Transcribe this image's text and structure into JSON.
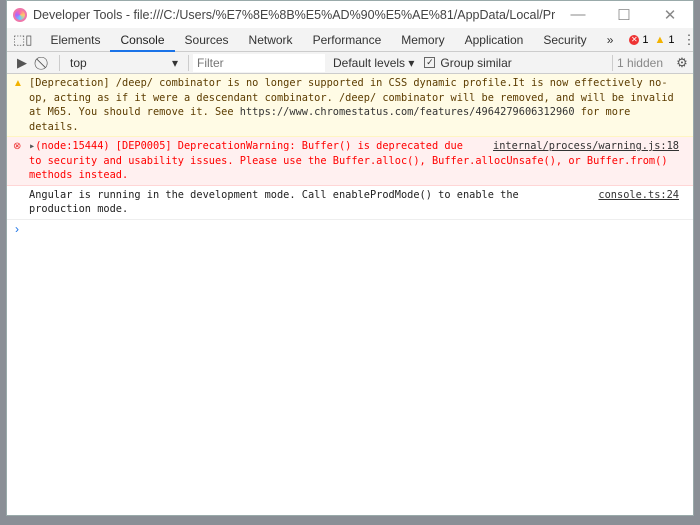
{
  "window": {
    "title": "Developer Tools - file:///C:/Users/%E7%8E%8B%E5%AD%90%E5%AE%81/AppData/Local/Programs/myca..."
  },
  "tabs": [
    {
      "label": "Elements"
    },
    {
      "label": "Console",
      "active": true
    },
    {
      "label": "Sources"
    },
    {
      "label": "Network"
    },
    {
      "label": "Performance"
    },
    {
      "label": "Memory"
    },
    {
      "label": "Application"
    },
    {
      "label": "Security"
    }
  ],
  "more_tabs": "»",
  "counts": {
    "errors": "1",
    "warnings": "1"
  },
  "toolbar": {
    "context": "top",
    "filter_placeholder": "Filter",
    "levels": "Default levels",
    "group_similar": "Group similar",
    "hidden": "1 hidden"
  },
  "messages": [
    {
      "type": "warning",
      "text": "[Deprecation] /deep/ combinator is no longer supported in CSS dynamic profile.It is now effectively no-op, acting as if it were a descendant combinator. /deep/ combinator will be removed, and will be invalid at M65. You should remove it. See ",
      "link": "https://www.chromestatus.com/features/4964279606312960",
      "after": " for more details."
    },
    {
      "type": "error",
      "text": "(node:15444) [DEP0005] DeprecationWarning: Buffer() is deprecated due to security and usability issues. Please use the Buffer.alloc(), Buffer.allocUnsafe(), or Buffer.from() methods instead.",
      "source": "internal/process/warning.js:18"
    },
    {
      "type": "info",
      "text": "Angular is running in the development mode. Call enableProdMode() to enable the production mode.",
      "source": "console.ts:24"
    }
  ],
  "colors": {
    "accent": "#1a73e8",
    "error": "#ff0000",
    "warning_bg": "#fffbe5",
    "error_bg": "#fff0f0"
  }
}
